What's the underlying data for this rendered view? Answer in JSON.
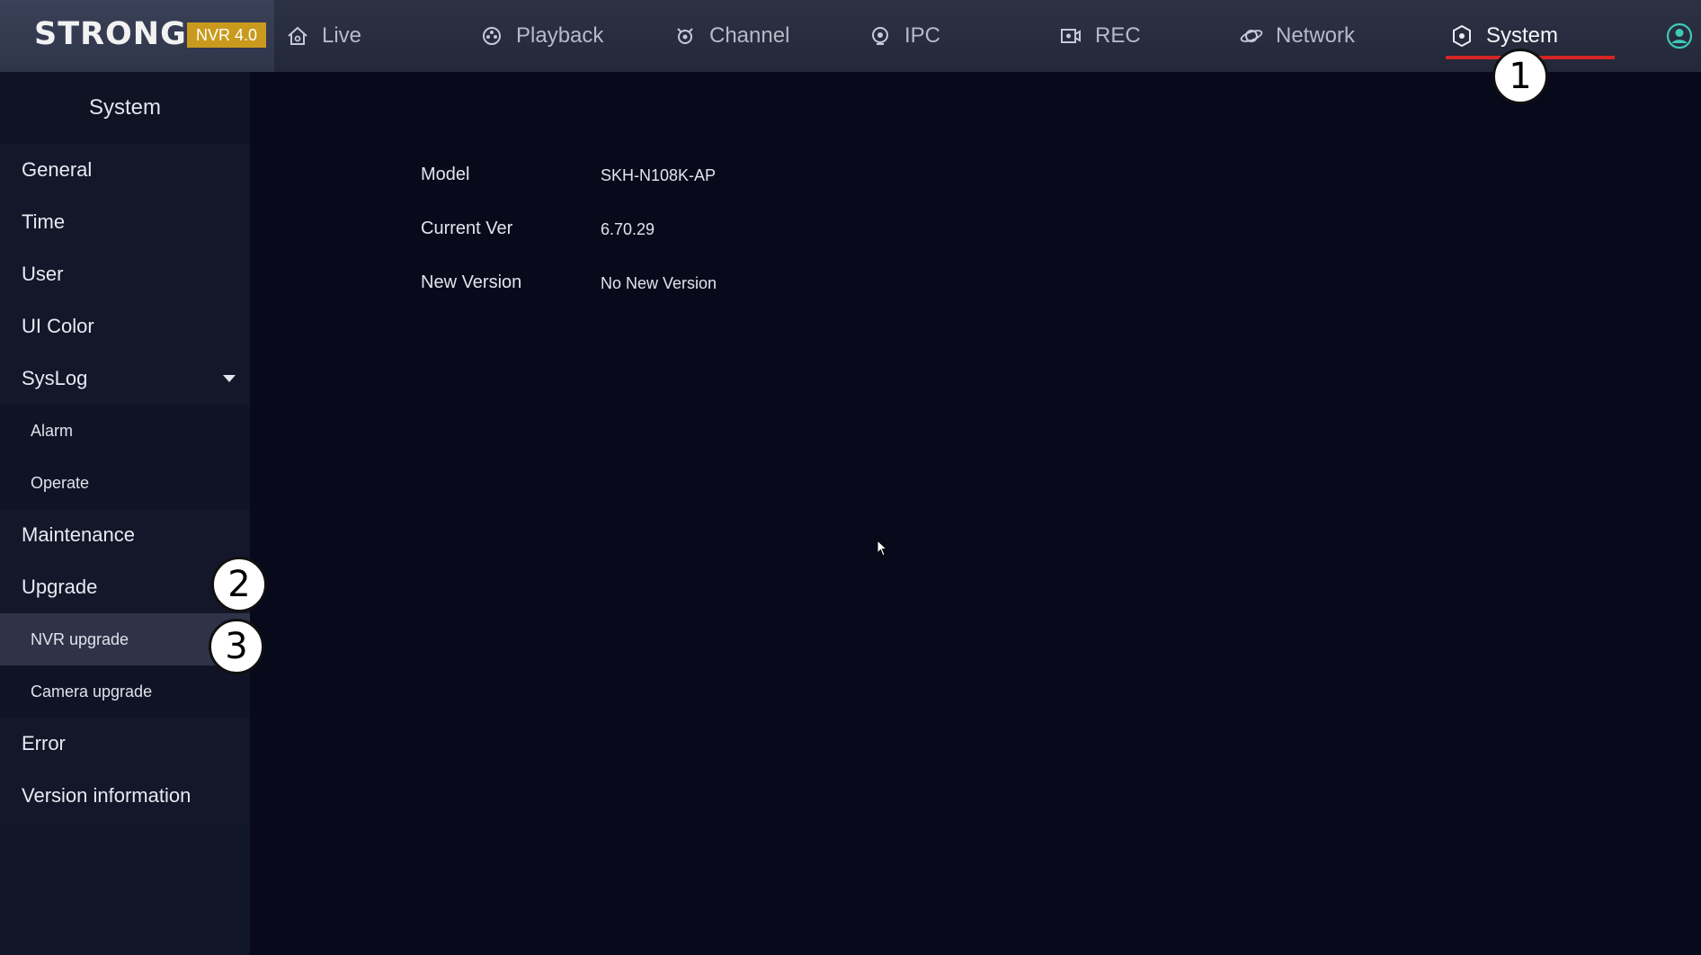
{
  "brand": {
    "logo": "STRONG",
    "version_badge": "NVR 4.0"
  },
  "nav": {
    "items": [
      {
        "label": "Live",
        "icon": "home-icon"
      },
      {
        "label": "Playback",
        "icon": "playback-icon"
      },
      {
        "label": "Channel",
        "icon": "channel-icon"
      },
      {
        "label": "IPC",
        "icon": "ipc-icon"
      },
      {
        "label": "REC",
        "icon": "rec-icon"
      },
      {
        "label": "Network",
        "icon": "network-icon"
      },
      {
        "label": "System",
        "icon": "system-icon"
      }
    ],
    "active": "System",
    "user_icon": "user-icon"
  },
  "sidebar": {
    "header": "System",
    "items": [
      {
        "label": "General"
      },
      {
        "label": "Time"
      },
      {
        "label": "User"
      },
      {
        "label": "UI  Color"
      },
      {
        "label": "SysLog"
      },
      {
        "label": "Alarm"
      },
      {
        "label": "Operate"
      },
      {
        "label": "Maintenance"
      },
      {
        "label": "Upgrade"
      },
      {
        "label": "NVR  upgrade"
      },
      {
        "label": "Camera  upgrade"
      },
      {
        "label": "Error"
      },
      {
        "label": "Version  information"
      }
    ],
    "selected": "NVR  upgrade"
  },
  "info": {
    "rows": [
      {
        "label": "Model",
        "value": "SKH-N108K-AP"
      },
      {
        "label": "Current  Ver",
        "value": "6.70.29"
      },
      {
        "label": "New  Version",
        "value": "No  New  Version"
      }
    ]
  },
  "callouts": [
    "1",
    "2",
    "3"
  ],
  "colors": {
    "accent_underline": "#d42525",
    "badge": "#c99a1e",
    "background": "#080a1c",
    "sidebar": "#121629",
    "selected": "#2e3347"
  }
}
